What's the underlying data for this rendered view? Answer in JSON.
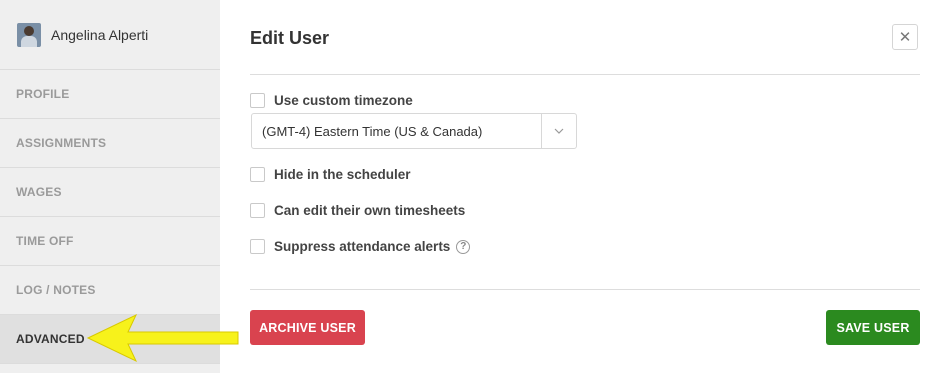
{
  "sidebar": {
    "user_name": "Angelina Alperti",
    "items": [
      {
        "label": "PROFILE"
      },
      {
        "label": "ASSIGNMENTS"
      },
      {
        "label": "WAGES"
      },
      {
        "label": "TIME OFF"
      },
      {
        "label": "LOG / NOTES"
      },
      {
        "label": "ADVANCED"
      }
    ],
    "active_item": "ADVANCED"
  },
  "dialog": {
    "title": "Edit User",
    "close_icon": "close-icon",
    "options": {
      "custom_timezone_label": "Use custom timezone",
      "timezone_value": "(GMT-4) Eastern Time (US & Canada)",
      "hide_scheduler_label": "Hide in the scheduler",
      "edit_timesheets_label": "Can edit their own timesheets",
      "suppress_alerts_label": "Suppress attendance alerts"
    },
    "archive_label": "ARCHIVE USER",
    "save_label": "SAVE USER"
  },
  "colors": {
    "archive": "#d9434f",
    "save": "#2b8a1f",
    "annotation_arrow": "#f7f21b"
  }
}
